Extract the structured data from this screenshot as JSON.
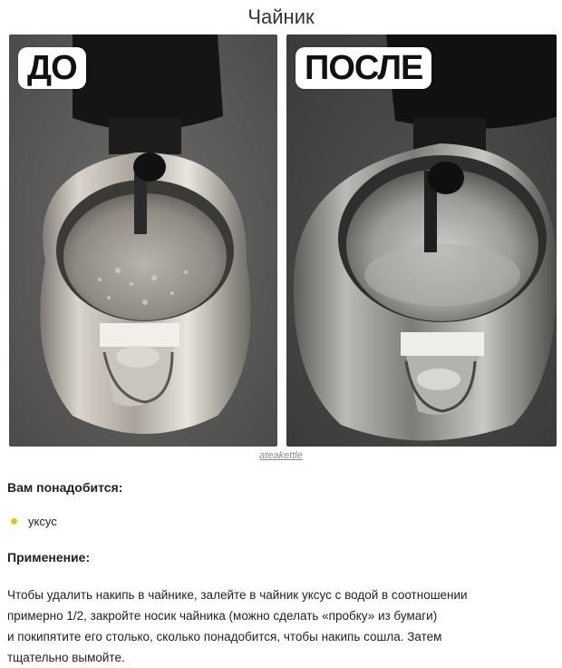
{
  "title": "Чайник",
  "before": {
    "label": "ДО"
  },
  "after": {
    "label": "ПОСЛЕ"
  },
  "credit": "ateakettle",
  "needs": {
    "heading": "Вам понадобится:",
    "items": [
      "уксус"
    ],
    "bullet_color": "#e3c12a"
  },
  "usage": {
    "heading": "Применение:",
    "lines": [
      "Чтобы удалить накипь в чайнике, залейте в чайник уксус с водой в соотношении",
      "примерно 1/2, закройте носик чайника (можно сделать «пробку» из бумаги)",
      "и покипятите его столько, сколько понадобится, чтобы накипь сошла. Затем",
      "тщательно вымойте."
    ]
  }
}
